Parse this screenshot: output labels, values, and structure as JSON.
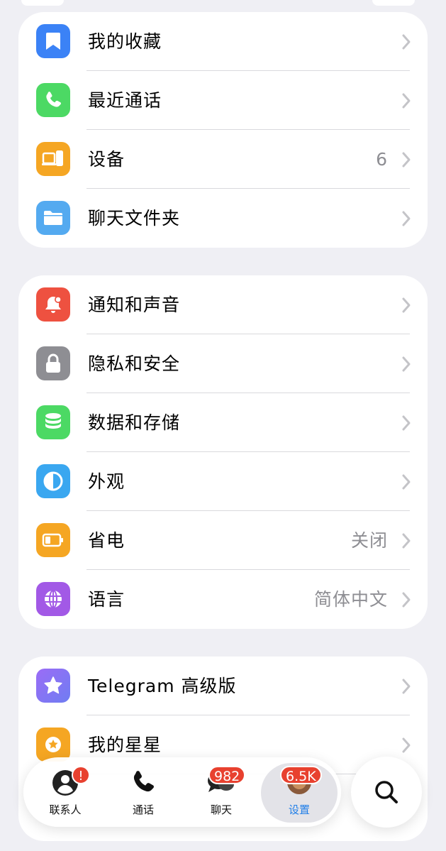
{
  "groups": [
    {
      "items": [
        {
          "label": "我的收藏",
          "value": "",
          "icon": "bookmark-icon",
          "color": "#3b82f6"
        },
        {
          "label": "最近通话",
          "value": "",
          "icon": "phone-icon",
          "color": "#4cd964"
        },
        {
          "label": "设备",
          "value": "6",
          "icon": "devices-icon",
          "color": "#f5a623"
        },
        {
          "label": "聊天文件夹",
          "value": "",
          "icon": "folder-icon",
          "color": "#54aaf0"
        }
      ]
    },
    {
      "items": [
        {
          "label": "通知和声音",
          "value": "",
          "icon": "bell-icon",
          "color": "#ee5140"
        },
        {
          "label": "隐私和安全",
          "value": "",
          "icon": "lock-icon",
          "color": "#8e8e93"
        },
        {
          "label": "数据和存储",
          "value": "",
          "icon": "database-icon",
          "color": "#4cd964"
        },
        {
          "label": "外观",
          "value": "",
          "icon": "appearance-icon",
          "color": "#3aa7f0"
        },
        {
          "label": "省电",
          "value": "关闭",
          "icon": "battery-icon",
          "color": "#f5a623"
        },
        {
          "label": "语言",
          "value": "简体中文",
          "icon": "globe-icon",
          "color": "#a259e6"
        }
      ]
    },
    {
      "items": [
        {
          "label": "Telegram 高级版",
          "value": "",
          "icon": "premium-star-icon",
          "color": "#8c6cf5"
        },
        {
          "label": "我的星星",
          "value": "",
          "icon": "stars-icon",
          "color": "#f5a623"
        }
      ]
    }
  ],
  "tabbar": {
    "tabs": [
      {
        "label": "联系人",
        "badge": "!",
        "icon": "contacts-icon"
      },
      {
        "label": "通话",
        "badge": "",
        "icon": "phone-icon"
      },
      {
        "label": "聊天",
        "badge": "982",
        "icon": "chats-icon"
      },
      {
        "label": "设置",
        "badge": "6.5K",
        "icon": "settings-avatar-icon",
        "active": true
      }
    ],
    "search_icon": "search-icon"
  },
  "colors": {
    "accent": "#1f7ee8",
    "badge": "#e8412f",
    "background": "#efeff4"
  }
}
